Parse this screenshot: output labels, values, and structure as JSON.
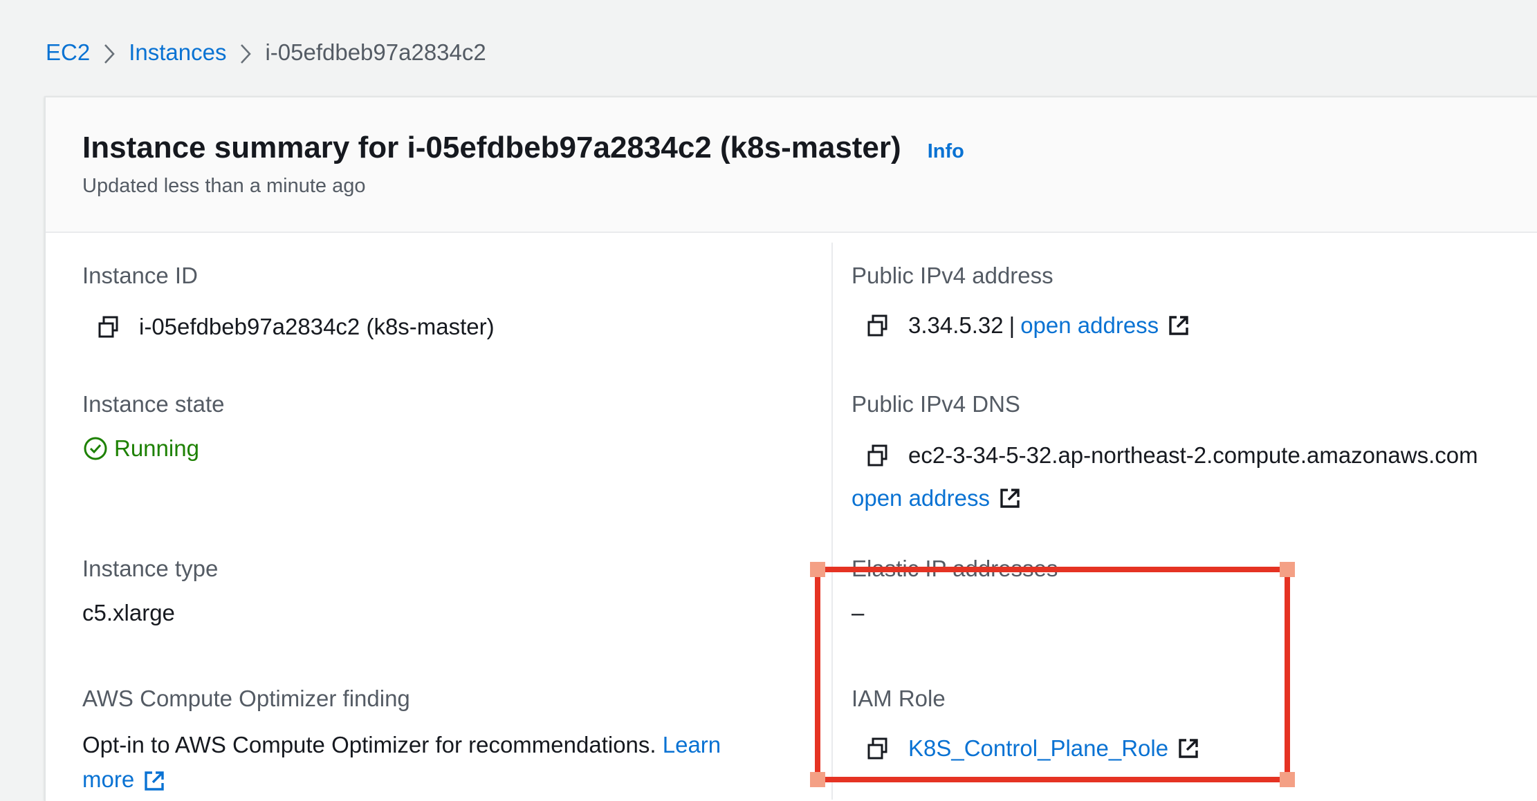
{
  "breadcrumb": {
    "items": [
      "EC2",
      "Instances"
    ],
    "current": "i-05efdbeb97a2834c2"
  },
  "header": {
    "title": "Instance summary for i-05efdbeb97a2834c2 (k8s-master)",
    "info_label": "Info",
    "updated": "Updated less than a minute ago"
  },
  "left": {
    "instance_id_label": "Instance ID",
    "instance_id_value": "i-05efdbeb97a2834c2 (k8s-master)",
    "instance_state_label": "Instance state",
    "instance_state_value": "Running",
    "instance_type_label": "Instance type",
    "instance_type_value": "c5.xlarge",
    "optimizer_label": "AWS Compute Optimizer finding",
    "optimizer_text": "Opt-in to AWS Compute Optimizer for recommendations.",
    "optimizer_link_1": "Learn",
    "optimizer_link_2": "more"
  },
  "right": {
    "ipv4_label": "Public IPv4 address",
    "ipv4_value": "3.34.5.32",
    "ipv4_separator": "|",
    "ipv4_link": "open address",
    "dns_label": "Public IPv4 DNS",
    "dns_value": "ec2-3-34-5-32.ap-northeast-2.compute.amazonaws.com",
    "dns_link": "open address",
    "elastic_label": "Elastic IP addresses",
    "elastic_value": "–",
    "iam_label": "IAM Role",
    "iam_value": "K8S_Control_Plane_Role"
  },
  "colors": {
    "link": "#0972d3",
    "status_running": "#1d8102",
    "highlight": "#e53323"
  },
  "icons": [
    "chevron-right-icon",
    "copy-icon",
    "check-circle-icon",
    "external-link-icon"
  ]
}
